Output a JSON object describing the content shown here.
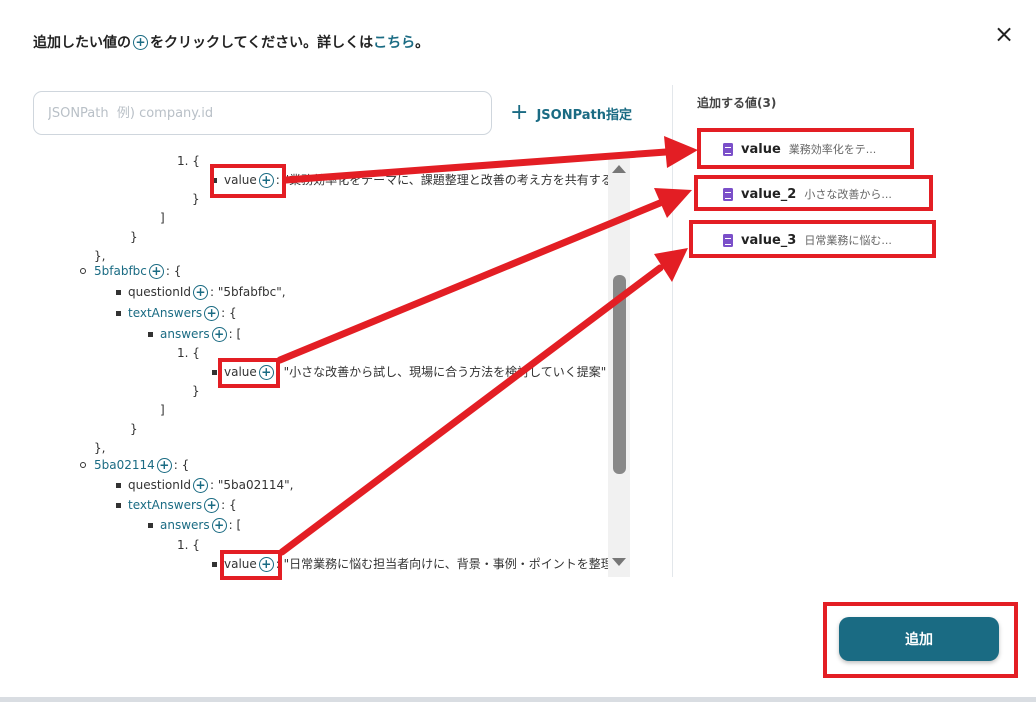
{
  "header": {
    "text_before": "追加したい値の",
    "plus_symbol": "+",
    "text_middle": "をクリックしてください。詳しくは",
    "link_text": "こちら",
    "text_after": "。"
  },
  "close_label": "×",
  "search": {
    "placeholder": "JSONPath  例) company.id",
    "value": ""
  },
  "jsonpath_button": {
    "icon": "+",
    "label": "JSONPath指定"
  },
  "right_panel": {
    "title": "追加する値(3)",
    "items": [
      {
        "name": "value",
        "preview": "業務効率化をテ..."
      },
      {
        "name": "value_2",
        "preview": "小さな改善から..."
      },
      {
        "name": "value_3",
        "preview": "日常業務に悩む..."
      }
    ]
  },
  "tree": {
    "plus": "+",
    "l1_num": "1. {",
    "l1_key": "value",
    "l1_text": ": \"業務効率化をテーマに、課題整理と改善の考え方を共有する",
    "close_brace": "}",
    "close_bracket": "]",
    "close_brace_comma": "},",
    "key_5bf": "5bfabfbc",
    "open_obj": ": {",
    "questionId_key": "questionId",
    "questionId_5bf": ": \"5bfabfbc\",",
    "textAnswers_key": "textAnswers",
    "answers_key": "answers",
    "open_arr": ": [",
    "l2_text": ": \"小さな改善から試し、現場に合う方法を検討していく提案\"",
    "key_5ba": "5ba02114",
    "questionId_5ba": ": \"5ba02114\",",
    "l3_text": ": \"日常業務に悩む担当者向けに、背景・事例・ポイントを整理\""
  },
  "add_button": {
    "label": "追加"
  },
  "colors": {
    "accent": "#1a6b83",
    "highlight": "#e31e24",
    "doc_icon": "#7b4fc9"
  }
}
